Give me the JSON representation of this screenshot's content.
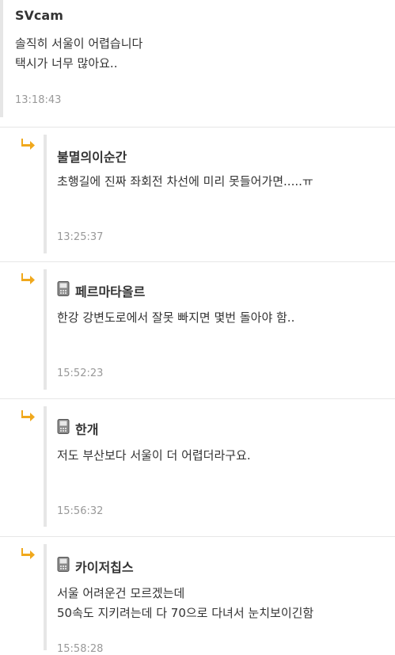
{
  "comments": [
    {
      "nick": "SVcam",
      "text": "솔직히 서울이 어렵습니다\n택시가 너무 많아요..",
      "time": "13:18:43",
      "mobile": false
    },
    {
      "nick": "불멸의이순간",
      "text": "초행길에 진짜 좌회전 차선에 미리 못들어가면.....ㅠ",
      "time": "13:25:37",
      "mobile": false
    },
    {
      "nick": "페르마타올르",
      "text": "한강 강변도로에서 잘못 빠지면 몇번 돌아야 함..",
      "time": "15:52:23",
      "mobile": true
    },
    {
      "nick": "한개",
      "text": "저도 부산보다 서울이 더 어렵더라구요.",
      "time": "15:56:32",
      "mobile": true
    },
    {
      "nick": "카이저칩스",
      "text": "서울 어려운건 모르겠는데\n50속도 지키려는데 다 70으로 다녀서 눈치보이긴함",
      "time": "15:58:28",
      "mobile": true
    }
  ],
  "icons": {
    "reply": "reply-arrow-icon",
    "mobile": "mobile-phone-icon"
  },
  "colors": {
    "reply_arrow": "#f0a81c",
    "bar": "#e6e6e6",
    "time": "#999999"
  }
}
